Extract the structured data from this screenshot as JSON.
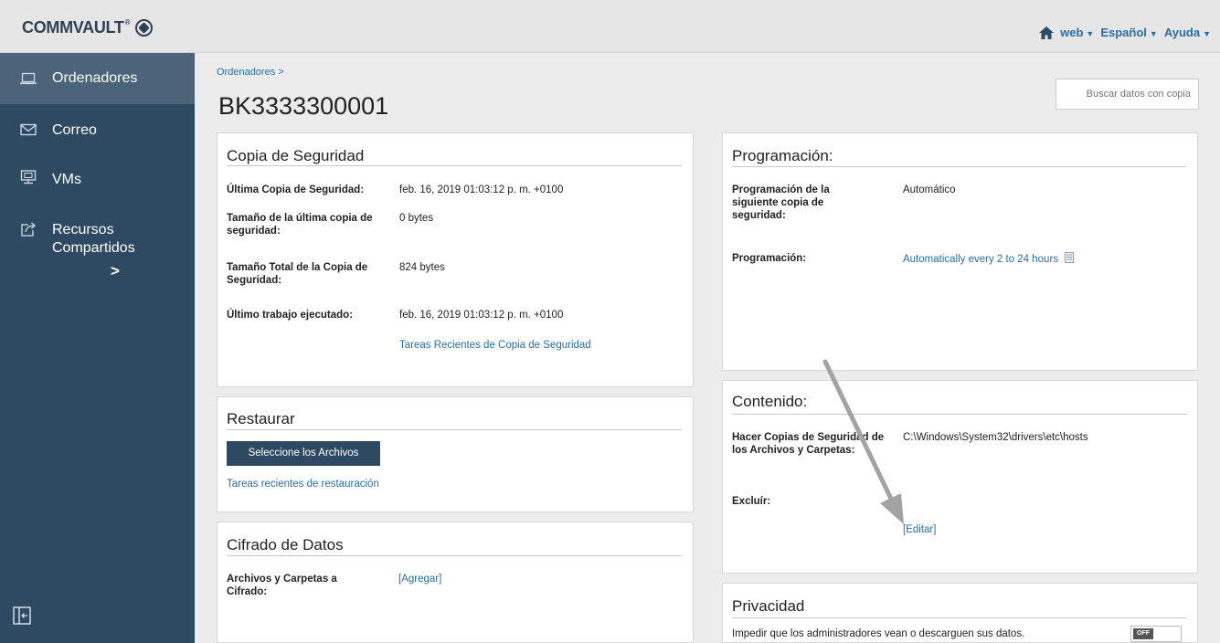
{
  "header": {
    "logo_text": "COMMVAULT",
    "logo_reg": "®",
    "user": "web",
    "language": "Español",
    "help": "Ayuda"
  },
  "sidebar": {
    "items": [
      {
        "label": "Ordenadores",
        "icon": "laptop-icon",
        "active": true
      },
      {
        "label": "Correo",
        "icon": "envelope-icon"
      },
      {
        "label": "VMs",
        "icon": "vm-icon"
      },
      {
        "label": "Recursos Compartidos",
        "icon": "share-icon"
      }
    ],
    "expand_glyph": ">"
  },
  "breadcrumb": "Ordenadores >",
  "page_title": "BK3333300001",
  "search": {
    "placeholder": "Buscar datos con copia"
  },
  "backup": {
    "title": "Copia de Seguridad",
    "rows": [
      {
        "label": "Última Copia de Seguridad:",
        "value": "feb. 16, 2019 01:03:12 p. m. +0100"
      },
      {
        "label": "Tamaño de la última copia de seguridad:",
        "value": "0 bytes"
      },
      {
        "label": "Tamaño Total de la Copia de Seguridad:",
        "value": "824 bytes"
      },
      {
        "label": "Último trabajo ejecutado:",
        "value": "feb. 16, 2019 01:03:12 p. m. +0100"
      }
    ],
    "recent_link": "Tareas Recientes de Copia de Seguridad"
  },
  "restore": {
    "title": "Restaurar",
    "button": "Seleccione los Archivos",
    "recent_link": "Tareas recientes de restauración"
  },
  "encryption": {
    "title": "Cifrado de Datos",
    "label": "Archivos y Carpetas a Cifrado:",
    "add_link": "[Agregar]"
  },
  "schedule": {
    "title": "Programación:",
    "next_label": "Programación de la siguiente copia de seguridad:",
    "next_value": "Automático",
    "schedule_label": "Programación:",
    "schedule_link": "Automatically every 2 to 24 hours"
  },
  "content": {
    "title": "Contenido:",
    "backup_label": "Hacer Copias de Seguridad de los Archivos y Carpetas:",
    "backup_value": "C:\\Windows\\System32\\drivers\\etc\\hosts",
    "exclude_label": "Excluír:",
    "edit_link": "[Editar]"
  },
  "privacy": {
    "title": "Privacidad",
    "text": "Impedir que los administradores vean o descarguen sus datos.",
    "toggle": "OFF"
  },
  "colors": {
    "sidebar": "#2e4a62",
    "sidebar_active": "#4b6479",
    "link": "#2a6ea6",
    "button": "#2e4a62"
  }
}
